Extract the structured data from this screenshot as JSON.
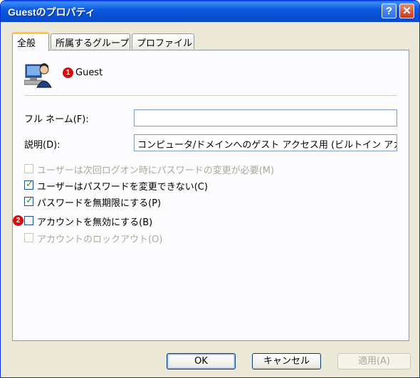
{
  "window": {
    "title": "Guestのプロパティ",
    "help_glyph": "?",
    "close_glyph": "✕"
  },
  "tabs": [
    {
      "label": "全般"
    },
    {
      "label": "所属するグループ"
    },
    {
      "label": "プロファイル"
    }
  ],
  "user": {
    "name": "Guest",
    "icon": "user-account-icon"
  },
  "badges": {
    "one": "1",
    "two": "2"
  },
  "fields": {
    "fullname_label": "フル ネーム(F):",
    "fullname_value": "",
    "description_label": "説明(D):",
    "description_value": "コンピュータ/ドメインへのゲスト アクセス用 (ビルトイン アカウント"
  },
  "checkboxes": [
    {
      "label": "ユーザーは次回ログオン時にパスワードの変更が必要(M)",
      "checked": false,
      "enabled": false
    },
    {
      "label": "ユーザーはパスワードを変更できない(C)",
      "checked": true,
      "enabled": true
    },
    {
      "label": "パスワードを無期限にする(P)",
      "checked": true,
      "enabled": true
    },
    {
      "label": "アカウントを無効にする(B)",
      "checked": false,
      "enabled": true
    },
    {
      "label": "アカウントのロックアウト(O)",
      "checked": false,
      "enabled": false
    }
  ],
  "buttons": {
    "ok": "OK",
    "cancel": "キャンセル",
    "apply": "適用(A)"
  },
  "colors": {
    "titlebar": "#0a5fe8",
    "badge": "#d40d0d",
    "check": "#21a121",
    "tab_highlight": "#ffc83c"
  }
}
